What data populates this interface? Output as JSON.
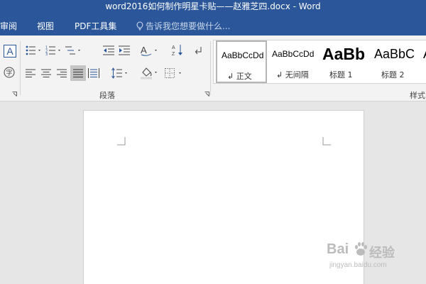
{
  "window": {
    "title": "word2016如何制作明星卡贴——赵雅芝四.docx - Word"
  },
  "tabs": [
    {
      "label": "审阅"
    },
    {
      "label": "视图"
    },
    {
      "label": "PDF工具集"
    }
  ],
  "tell_me": {
    "placeholder": "告诉我您想要做什么..."
  },
  "ribbon": {
    "paragraph_group": {
      "label": "段落"
    },
    "styles_group": {
      "label": "样式",
      "items": [
        {
          "preview": "AaBbCcDd",
          "label": "正文",
          "mark": "↲",
          "selected": true
        },
        {
          "preview": "AaBbCcDd",
          "label": "无间隔",
          "mark": "↲",
          "selected": false
        },
        {
          "preview": "AaBb",
          "label": "标题 1",
          "selected": false
        },
        {
          "preview": "AaBbC",
          "label": "标题 2",
          "selected": false
        }
      ]
    }
  },
  "watermark": {
    "brand": "Bai",
    "product": "经验",
    "url": "jingyan.baidu.com"
  },
  "colors": {
    "title_bar": "#2b579a",
    "ribbon_bg": "#f3f3f3",
    "canvas_bg": "#e6e6e6",
    "page_bg": "#ffffff"
  }
}
